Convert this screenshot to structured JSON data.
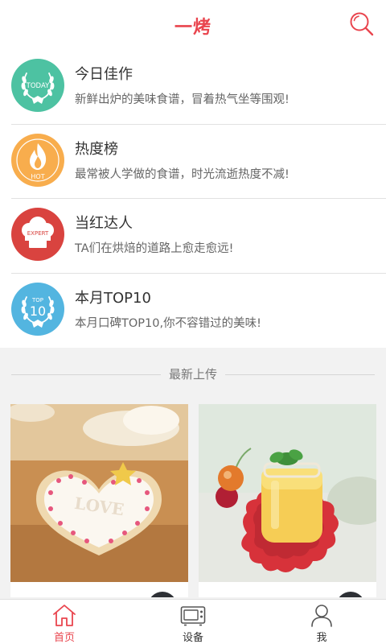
{
  "header": {
    "title": "一烤",
    "search_icon": "search-icon",
    "accent": "#e9454e"
  },
  "features": [
    {
      "title": "今日佳作",
      "subtitle": "新鲜出炉的美味食谱，冒着热气坐等围观!",
      "badge_text": "TODAY",
      "icon": "laurel-wreath-icon",
      "color": "#4dc2a2"
    },
    {
      "title": "热度榜",
      "subtitle": "最常被人学做的食谱，时光流逝热度不减!",
      "badge_text": "HOT",
      "icon": "flame-icon",
      "color": "#f8ad4d"
    },
    {
      "title": "当红达人",
      "subtitle": "TA们在烘焙的道路上愈走愈远!",
      "badge_text": "EXPERT",
      "icon": "chef-hat-icon",
      "color": "#d9433f"
    },
    {
      "title": "本月TOP10",
      "subtitle": "本月口碑TOP10,你不容错过的美味!",
      "badge_text": "TOP",
      "badge_number": "10",
      "icon": "laurel-wreath-icon",
      "color": "#53b5e0"
    }
  ],
  "latest": {
    "title": "最新上传",
    "cards": [
      {
        "image": "heart-cookie-photo",
        "icing_text": "LOVE"
      },
      {
        "image": "pudding-jar-photo"
      }
    ]
  },
  "tabs": [
    {
      "label": "首页",
      "icon": "home-icon",
      "active": true
    },
    {
      "label": "设备",
      "icon": "oven-icon",
      "active": false
    },
    {
      "label": "我",
      "icon": "user-icon",
      "active": false
    }
  ]
}
